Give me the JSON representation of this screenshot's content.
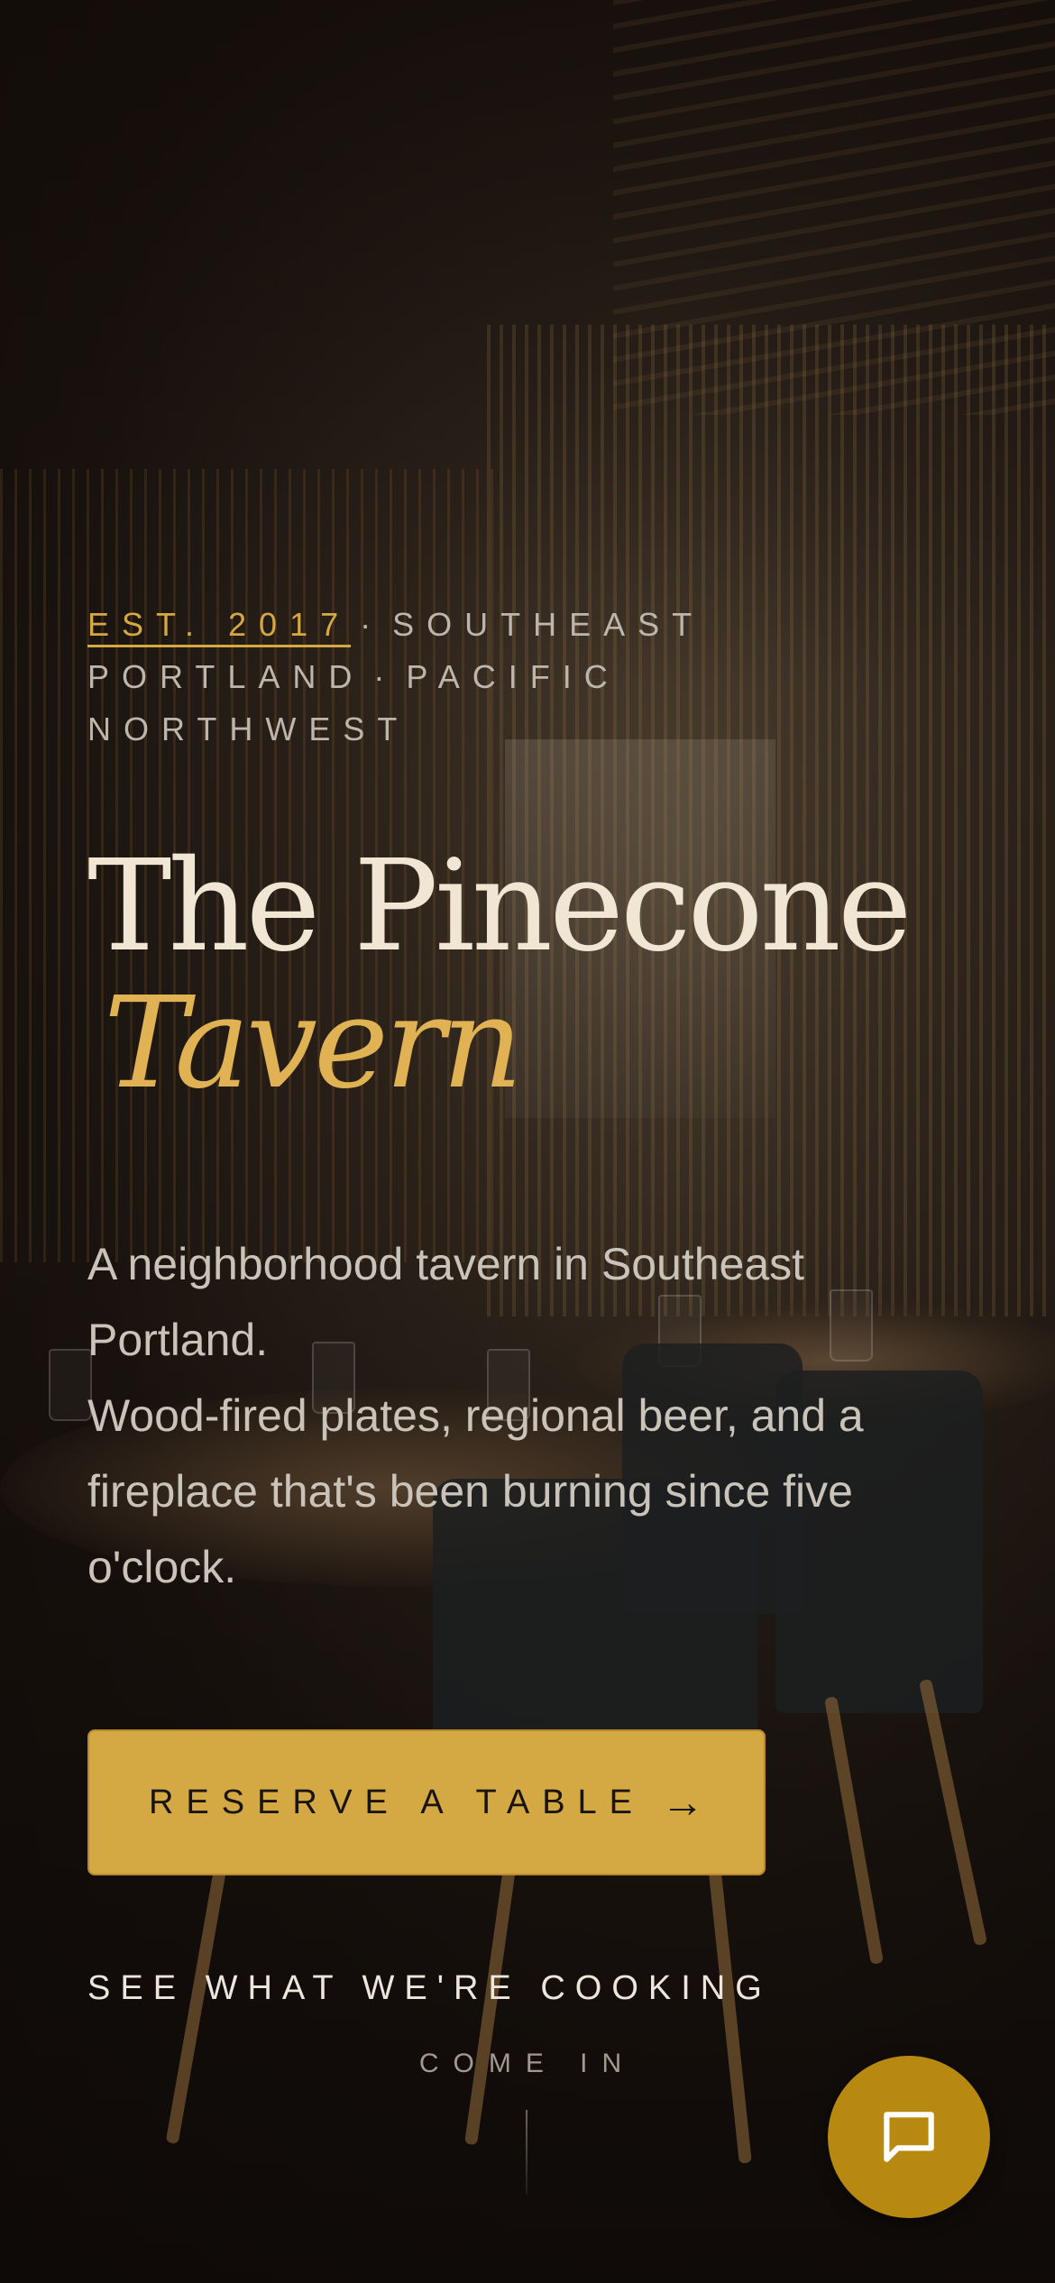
{
  "hero": {
    "eyebrow": {
      "est": "EST. 2017",
      "separator": "·",
      "location_1": "SOUTHEAST PORTLAND",
      "location_2": "PACIFIC NORTHWEST"
    },
    "title": {
      "main": "The Pinecone",
      "accent": "Tavern"
    },
    "lede": {
      "line_1": "A neighborhood tavern in Southeast Portland.",
      "line_2": "Wood-fired plates, regional beer, and a fireplace that's been burning since five o'clock."
    },
    "cta": {
      "label": "RESERVE A TABLE",
      "arrow": "→"
    },
    "secondary_link": "SEE WHAT WE'RE COOKING",
    "scroll_hint": "COME IN"
  },
  "chat": {
    "icon": "chat-bubble-icon"
  },
  "colors": {
    "accent": "#d4a843",
    "accent_text": "#e0b253",
    "fab": "#b88911",
    "title": "#f1e6d3",
    "body": "#c9c3ba",
    "background": "#120d0a"
  }
}
